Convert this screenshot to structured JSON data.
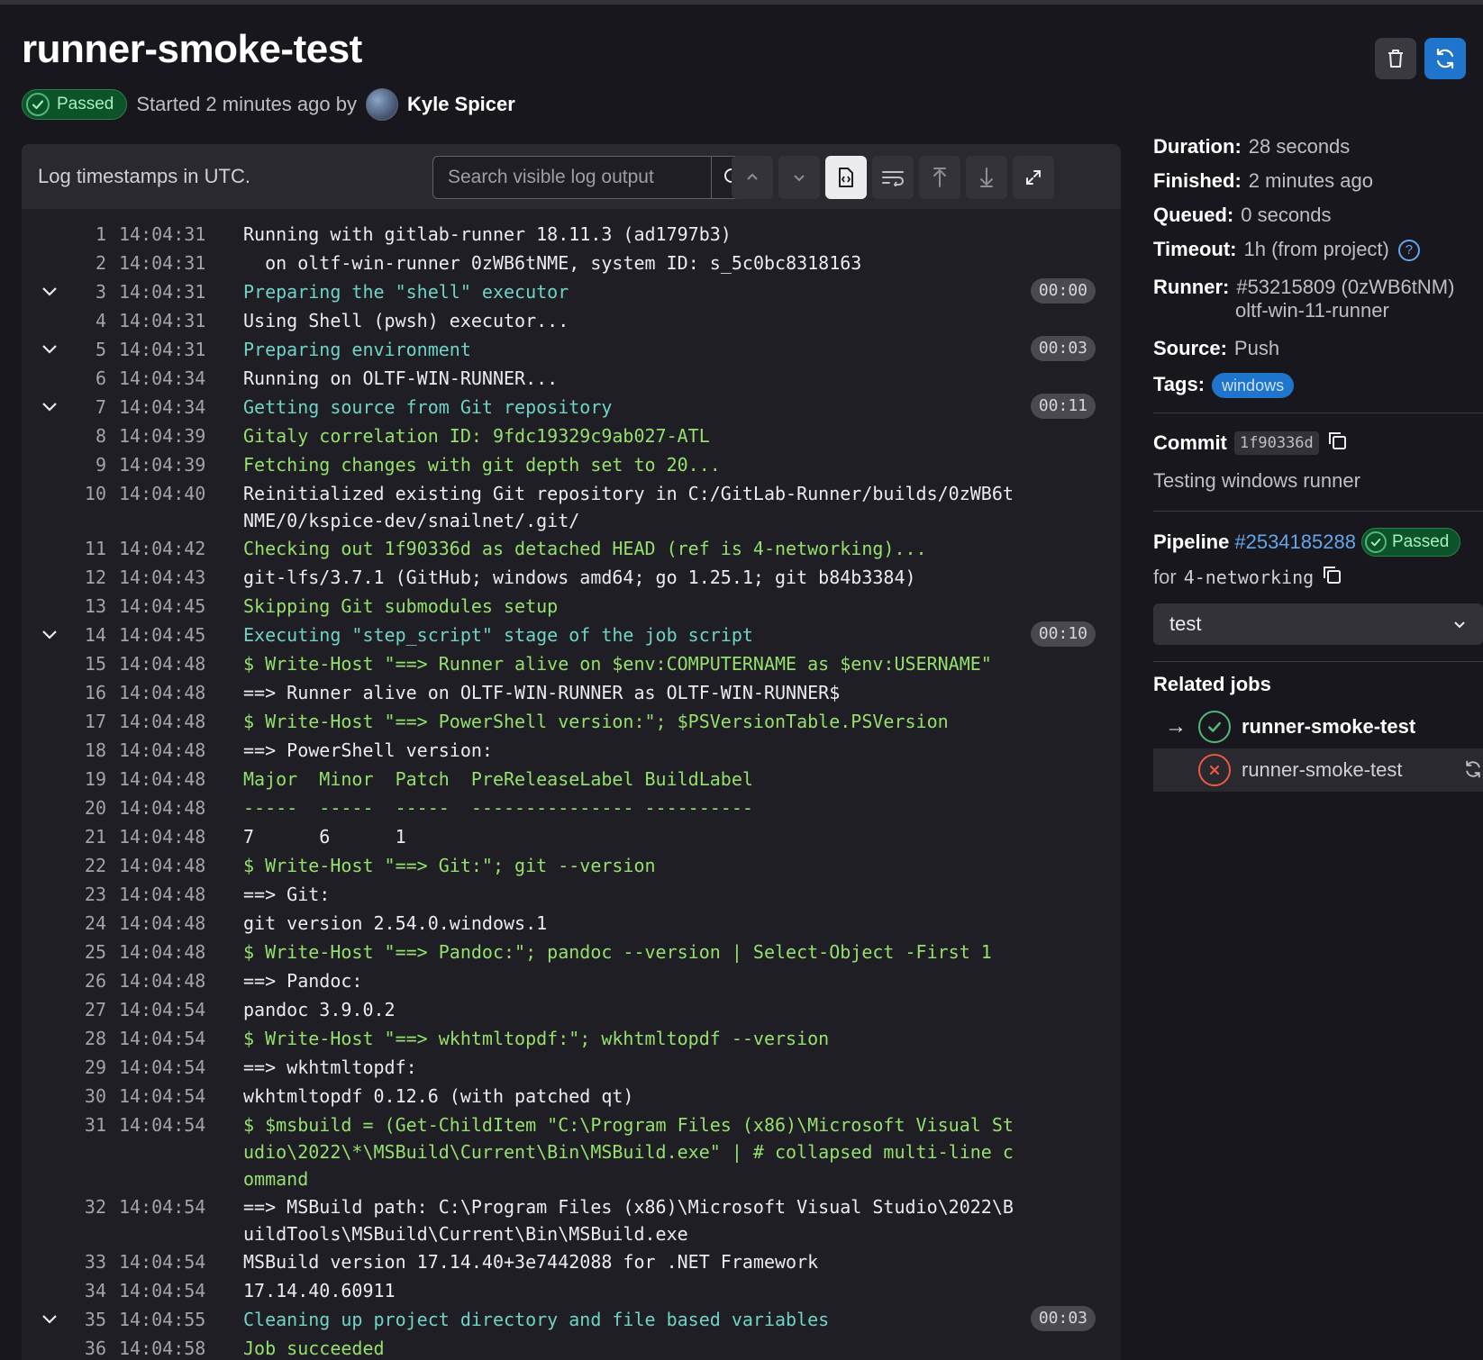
{
  "job": {
    "title": "runner-smoke-test",
    "status": "Passed",
    "started_text": "Started 2 minutes ago by",
    "author": "Kyle Spicer"
  },
  "header_buttons": {
    "delete_icon": "trash-icon",
    "retry_icon": "retry-icon"
  },
  "log": {
    "timestamps_note": "Log timestamps in UTC.",
    "search_placeholder": "Search visible log output",
    "lines": [
      {
        "n": "1",
        "t": "14:04:31",
        "text": "Running with gitlab-runner 18.11.3 (ad1797b3)",
        "kind": "plain"
      },
      {
        "n": "2",
        "t": "14:04:31",
        "text": "  on oltf-win-runner 0zWB6tNME, system ID: s_5c0bc8318163",
        "kind": "plain"
      },
      {
        "n": "3",
        "t": "14:04:31",
        "text": "Preparing the \"shell\" executor",
        "kind": "section",
        "dur": "00:00"
      },
      {
        "n": "4",
        "t": "14:04:31",
        "text": "Using Shell (pwsh) executor...",
        "kind": "plain"
      },
      {
        "n": "5",
        "t": "14:04:31",
        "text": "Preparing environment",
        "kind": "section",
        "dur": "00:03"
      },
      {
        "n": "6",
        "t": "14:04:34",
        "text": "Running on OLTF-WIN-RUNNER...",
        "kind": "plain"
      },
      {
        "n": "7",
        "t": "14:04:34",
        "text": "Getting source from Git repository",
        "kind": "section",
        "dur": "00:11"
      },
      {
        "n": "8",
        "t": "14:04:39",
        "text": "Gitaly correlation ID: 9fdc19329c9ab027-ATL",
        "kind": "green"
      },
      {
        "n": "9",
        "t": "14:04:39",
        "text": "Fetching changes with git depth set to 20...",
        "kind": "green"
      },
      {
        "n": "10",
        "t": "14:04:40",
        "text": "Reinitialized existing Git repository in C:/GitLab-Runner/builds/0zWB6tNME/0/kspice-dev/snailnet/.git/",
        "kind": "plain"
      },
      {
        "n": "11",
        "t": "14:04:42",
        "text": "Checking out 1f90336d as detached HEAD (ref is 4-networking)...",
        "kind": "green"
      },
      {
        "n": "12",
        "t": "14:04:43",
        "text": "git-lfs/3.7.1 (GitHub; windows amd64; go 1.25.1; git b84b3384)",
        "kind": "plain"
      },
      {
        "n": "13",
        "t": "14:04:45",
        "text": "Skipping Git submodules setup",
        "kind": "green"
      },
      {
        "n": "14",
        "t": "14:04:45",
        "text": "Executing \"step_script\" stage of the job script",
        "kind": "section",
        "dur": "00:10"
      },
      {
        "n": "15",
        "t": "14:04:48",
        "text": "$ Write-Host \"==> Runner alive on $env:COMPUTERNAME as $env:USERNAME\"",
        "kind": "green"
      },
      {
        "n": "16",
        "t": "14:04:48",
        "text": "==> Runner alive on OLTF-WIN-RUNNER as OLTF-WIN-RUNNER$",
        "kind": "plain"
      },
      {
        "n": "17",
        "t": "14:04:48",
        "text": "$ Write-Host \"==> PowerShell version:\"; $PSVersionTable.PSVersion",
        "kind": "green"
      },
      {
        "n": "18",
        "t": "14:04:48",
        "text": "==> PowerShell version:",
        "kind": "plain"
      },
      {
        "n": "19",
        "t": "14:04:48",
        "text": "Major  Minor  Patch  PreReleaseLabel BuildLabel",
        "kind": "green"
      },
      {
        "n": "20",
        "t": "14:04:48",
        "text": "-----  -----  -----  --------------- ----------",
        "kind": "green"
      },
      {
        "n": "21",
        "t": "14:04:48",
        "text": "7      6      1",
        "kind": "plain"
      },
      {
        "n": "22",
        "t": "14:04:48",
        "text": "$ Write-Host \"==> Git:\"; git --version",
        "kind": "green"
      },
      {
        "n": "23",
        "t": "14:04:48",
        "text": "==> Git:",
        "kind": "plain"
      },
      {
        "n": "24",
        "t": "14:04:48",
        "text": "git version 2.54.0.windows.1",
        "kind": "plain"
      },
      {
        "n": "25",
        "t": "14:04:48",
        "text": "$ Write-Host \"==> Pandoc:\"; pandoc --version | Select-Object -First 1",
        "kind": "green"
      },
      {
        "n": "26",
        "t": "14:04:48",
        "text": "==> Pandoc:",
        "kind": "plain"
      },
      {
        "n": "27",
        "t": "14:04:54",
        "text": "pandoc 3.9.0.2",
        "kind": "plain"
      },
      {
        "n": "28",
        "t": "14:04:54",
        "text": "$ Write-Host \"==> wkhtmltopdf:\"; wkhtmltopdf --version",
        "kind": "green"
      },
      {
        "n": "29",
        "t": "14:04:54",
        "text": "==> wkhtmltopdf:",
        "kind": "plain"
      },
      {
        "n": "30",
        "t": "14:04:54",
        "text": "wkhtmltopdf 0.12.6 (with patched qt)",
        "kind": "plain"
      },
      {
        "n": "31",
        "t": "14:04:54",
        "text": "$ $msbuild = (Get-ChildItem \"C:\\Program Files (x86)\\Microsoft Visual Studio\\2022\\*\\MSBuild\\Current\\Bin\\MSBuild.exe\" | # collapsed multi-line command",
        "kind": "green"
      },
      {
        "n": "32",
        "t": "14:04:54",
        "text": "==> MSBuild path: C:\\Program Files (x86)\\Microsoft Visual Studio\\2022\\BuildTools\\MSBuild\\Current\\Bin\\MSBuild.exe",
        "kind": "plain"
      },
      {
        "n": "33",
        "t": "14:04:54",
        "text": "MSBuild version 17.14.40+3e7442088 for .NET Framework",
        "kind": "plain"
      },
      {
        "n": "34",
        "t": "14:04:54",
        "text": "17.14.40.60911",
        "kind": "plain"
      },
      {
        "n": "35",
        "t": "14:04:55",
        "text": "Cleaning up project directory and file based variables",
        "kind": "section",
        "dur": "00:03"
      },
      {
        "n": "36",
        "t": "14:04:58",
        "text": "Job succeeded",
        "kind": "green"
      }
    ]
  },
  "sidebar": {
    "duration_label": "Duration:",
    "duration": "28 seconds",
    "finished_label": "Finished:",
    "finished": "2 minutes ago",
    "queued_label": "Queued:",
    "queued": "0 seconds",
    "timeout_label": "Timeout:",
    "timeout": "1h (from project)",
    "runner_label": "Runner:",
    "runner_id": "#53215809 (0zWB6tNM)",
    "runner_name": "oltf-win-11-runner",
    "source_label": "Source:",
    "source": "Push",
    "tags_label": "Tags:",
    "tag": "windows",
    "commit_label": "Commit",
    "commit_sha": "1f90336d",
    "commit_message": "Testing windows runner",
    "pipeline_label": "Pipeline",
    "pipeline_id": "#2534185288",
    "pipeline_status": "Passed",
    "for_label": "for",
    "branch": "4-networking",
    "stage": "test",
    "related_jobs_title": "Related jobs",
    "related_jobs": [
      {
        "name": "runner-smoke-test",
        "status": "passed"
      },
      {
        "name": "runner-smoke-test",
        "status": "failed"
      }
    ]
  },
  "colors": {
    "success": "#52b87a",
    "failed": "#ec5941",
    "link": "#63a6e9",
    "section_text": "#6fd3c5",
    "command_text": "#95e06c"
  }
}
